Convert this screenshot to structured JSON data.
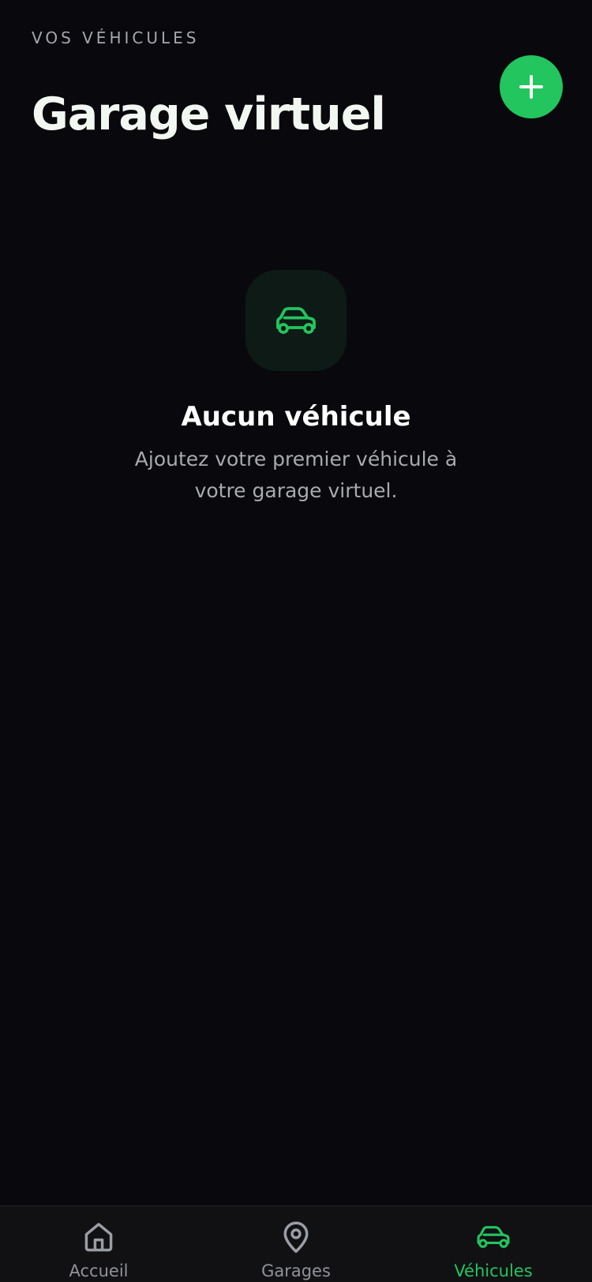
{
  "header": {
    "eyebrow": "VOS VÉHICULES",
    "title": "Garage virtuel",
    "add_icon": "plus-icon"
  },
  "empty_state": {
    "icon": "car-icon",
    "title": "Aucun véhicule",
    "description": "Ajoutez votre premier véhicule à votre garage virtuel."
  },
  "tabbar": {
    "items": [
      {
        "label": "Accueil",
        "icon": "home-icon",
        "active": false
      },
      {
        "label": "Garages",
        "icon": "map-pin-icon",
        "active": false
      },
      {
        "label": "Véhicules",
        "icon": "car-icon",
        "active": true
      }
    ]
  },
  "colors": {
    "background": "#09090d",
    "accent": "#22c55e",
    "tabbar_background": "#111114",
    "muted_text": "#a7aaae"
  }
}
